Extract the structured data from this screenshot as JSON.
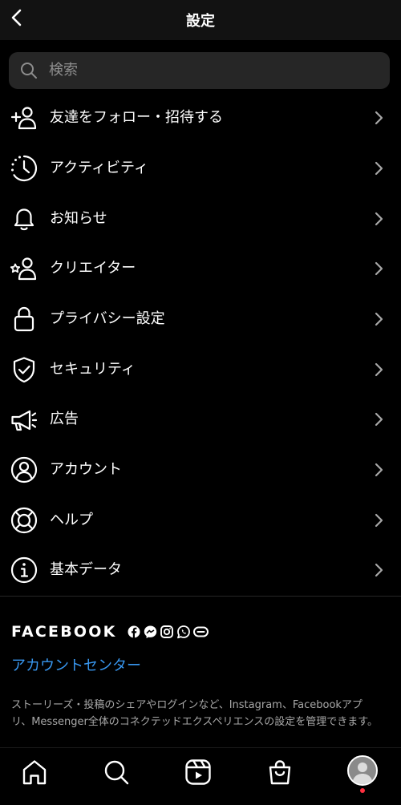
{
  "header": {
    "title": "設定",
    "back_icon": "chevron-left-icon"
  },
  "search": {
    "placeholder": "検索",
    "icon": "search-icon"
  },
  "menu": {
    "items": [
      {
        "label": "友達をフォロー・招待する",
        "icon": "add-person-icon"
      },
      {
        "label": "アクティビティ",
        "icon": "activity-clock-icon"
      },
      {
        "label": "お知らせ",
        "icon": "bell-icon"
      },
      {
        "label": "クリエイター",
        "icon": "creator-person-star-icon"
      },
      {
        "label": "プライバシー設定",
        "icon": "lock-icon"
      },
      {
        "label": "セキュリティ",
        "icon": "shield-check-icon"
      },
      {
        "label": "広告",
        "icon": "megaphone-icon"
      },
      {
        "label": "アカウント",
        "icon": "account-circle-icon"
      },
      {
        "label": "ヘルプ",
        "icon": "lifebuoy-icon"
      },
      {
        "label": "基本データ",
        "icon": "info-icon"
      }
    ]
  },
  "facebook": {
    "logo_text": "FACEBOOK",
    "app_icons": [
      "facebook-icon",
      "messenger-icon",
      "instagram-icon",
      "whatsapp-icon",
      "portal-icon"
    ],
    "account_center_label": "アカウントセンター",
    "description_line1": "ストーリーズ・投稿のシェアやログインなど、Instagram、Facebookアプ",
    "description_line2": "リ、Messenger全体のコネクテッドエクスペリエンスの設定を管理できます。"
  },
  "tabbar": {
    "tabs": [
      "home-icon",
      "search-icon",
      "reels-icon",
      "shop-icon",
      "profile-avatar"
    ]
  },
  "colors": {
    "background": "#000000",
    "header": "#121212",
    "search_field": "#262626",
    "link": "#3897f0",
    "secondary_text": "#a8a8a8",
    "notification_dot": "#ff3040"
  }
}
